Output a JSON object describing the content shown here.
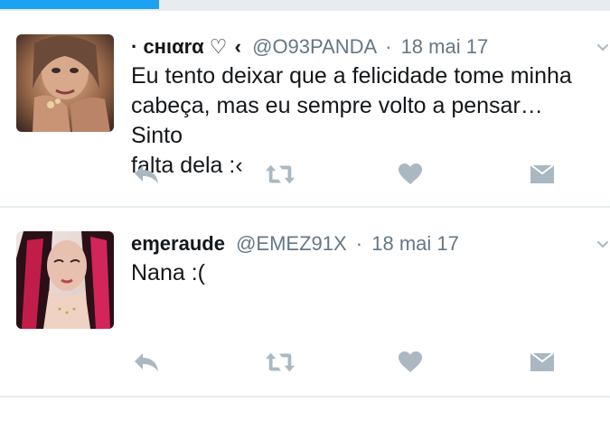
{
  "progress": {
    "fraction": 0.26,
    "color": "#1da1f2"
  },
  "tweets": [
    {
      "name": "· cнιαrα ♡",
      "name_extra": "‹",
      "handle": "@O93PANDA",
      "separator": "·",
      "time": "18 mai 17",
      "text_lines": [
        "Eu tento deixar que a felicidade tome minha",
        "cabeça, mas eu sempre volto a pensar… Sinto",
        "falta dela  :‹"
      ],
      "actions": [
        "reply-icon",
        "retweet-icon",
        "like-icon",
        "dm-icon"
      ],
      "menu_icon": "chevron-down-icon"
    },
    {
      "name": "eɱeraude",
      "handle": "@EMEZ91X",
      "separator": "·",
      "time": "18 mai 17",
      "text_lines": [
        "Nana :("
      ],
      "actions": [
        "reply-icon",
        "retweet-icon",
        "like-icon",
        "dm-icon"
      ],
      "menu_icon": "chevron-down-icon"
    }
  ],
  "colors": {
    "text": "#14171a",
    "secondary": "#657786",
    "icon": "#aab8c2",
    "divider": "#e6ecf0",
    "accent": "#1da1f2"
  }
}
